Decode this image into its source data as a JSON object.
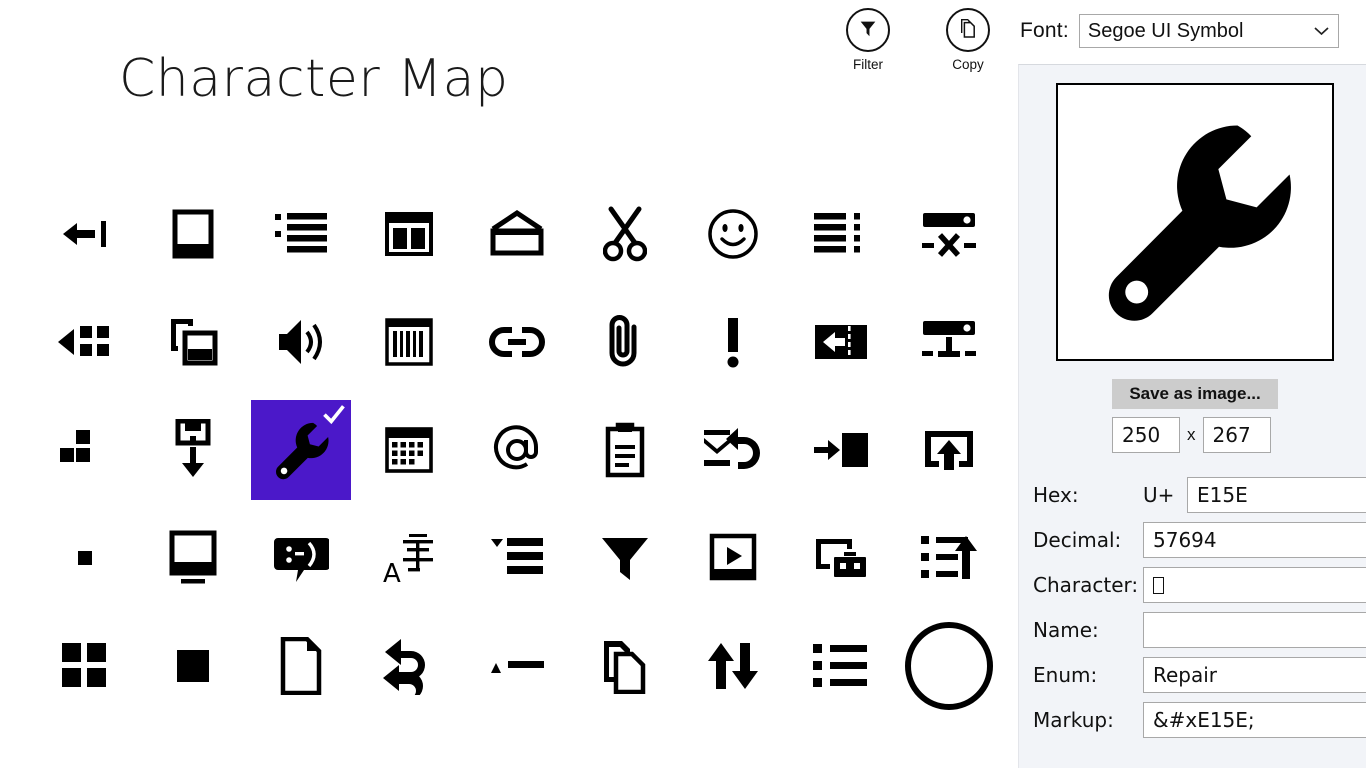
{
  "app": {
    "title": "Character Map",
    "accent_color": "#4b18c9",
    "panel_bg": "#f2f4f8"
  },
  "toolbar": {
    "filter_label": "Filter",
    "filter_icon": "filter-funnel-icon",
    "copy_label": "Copy",
    "copy_icon": "copy-pages-icon"
  },
  "font_selector": {
    "label": "Font:",
    "value": "Segoe UI Symbol",
    "chevron_icon": "chevron-down-icon"
  },
  "grid": {
    "columns": 9,
    "selected_index": 20,
    "selected_check_icon": "checkmark-icon",
    "cells": [
      {
        "index": 0,
        "icon": "back-to-window-icon"
      },
      {
        "index": 1,
        "icon": "tablet-portrait-icon"
      },
      {
        "index": 2,
        "icon": "bulleted-list-icon"
      },
      {
        "index": 3,
        "icon": "two-column-layout-icon"
      },
      {
        "index": 4,
        "icon": "open-envelope-icon"
      },
      {
        "index": 5,
        "icon": "scissors-icon"
      },
      {
        "index": 6,
        "icon": "smiley-face-icon"
      },
      {
        "index": 7,
        "icon": "list-with-dots-icon"
      },
      {
        "index": 8,
        "icon": "server-disconnect-icon"
      },
      {
        "index": 9,
        "icon": "back-to-tiles-icon"
      },
      {
        "index": 10,
        "icon": "copy-overlap-icon"
      },
      {
        "index": 11,
        "icon": "volume-speaker-icon"
      },
      {
        "index": 12,
        "icon": "barcode-icon"
      },
      {
        "index": 13,
        "icon": "link-chain-icon"
      },
      {
        "index": 14,
        "icon": "paperclip-icon"
      },
      {
        "index": 15,
        "icon": "exclamation-mark-icon"
      },
      {
        "index": 16,
        "icon": "eject-left-icon"
      },
      {
        "index": 17,
        "icon": "server-connect-icon"
      },
      {
        "index": 18,
        "icon": "tiles-small-icon"
      },
      {
        "index": 19,
        "icon": "save-download-icon"
      },
      {
        "index": 20,
        "icon": "wrench-repair-icon"
      },
      {
        "index": 21,
        "icon": "calendar-grid-icon"
      },
      {
        "index": 22,
        "icon": "at-sign-icon"
      },
      {
        "index": 23,
        "icon": "clipboard-paste-icon"
      },
      {
        "index": 24,
        "icon": "reply-all-mail-icon"
      },
      {
        "index": 25,
        "icon": "move-to-box-icon"
      },
      {
        "index": 26,
        "icon": "share-upload-icon"
      },
      {
        "index": 27,
        "icon": "small-square-icon"
      },
      {
        "index": 28,
        "icon": "monitor-screen-icon"
      },
      {
        "index": 29,
        "icon": "chat-smiley-bubble-icon"
      },
      {
        "index": 30,
        "icon": "language-translate-icon"
      },
      {
        "index": 31,
        "icon": "collapse-list-icon"
      },
      {
        "index": 32,
        "icon": "filter-funnel-icon"
      },
      {
        "index": 33,
        "icon": "video-play-frame-icon"
      },
      {
        "index": 34,
        "icon": "screen-toolbox-icon"
      },
      {
        "index": 35,
        "icon": "list-sort-up-icon"
      },
      {
        "index": 36,
        "icon": "four-tiles-icon"
      },
      {
        "index": 37,
        "icon": "filled-square-icon"
      },
      {
        "index": 38,
        "icon": "blank-page-icon"
      },
      {
        "index": 39,
        "icon": "reply-all-arrows-icon"
      },
      {
        "index": 40,
        "icon": "triangle-dash-icon"
      },
      {
        "index": 41,
        "icon": "copy-documents-icon"
      },
      {
        "index": 42,
        "icon": "sort-up-down-icon"
      },
      {
        "index": 43,
        "icon": "bulleted-list-squares-icon"
      },
      {
        "index": 44,
        "icon": "circle-outline-icon"
      }
    ]
  },
  "detail": {
    "preview_icon": "wrench-repair-icon",
    "save_button": "Save as image...",
    "width_value": "250",
    "size_separator": "x",
    "height_value": "267",
    "fields": [
      {
        "label": "Hex:",
        "prefix": "U+",
        "value": "E15E"
      },
      {
        "label": "Decimal:",
        "prefix": "",
        "value": "57694"
      },
      {
        "label": "Character:",
        "prefix": "",
        "value": ""
      },
      {
        "label": "Name:",
        "prefix": "",
        "value": ""
      },
      {
        "label": "Enum:",
        "prefix": "",
        "value": "Repair"
      },
      {
        "label": "Markup:",
        "prefix": "",
        "value": "&#xE15E;"
      }
    ]
  }
}
